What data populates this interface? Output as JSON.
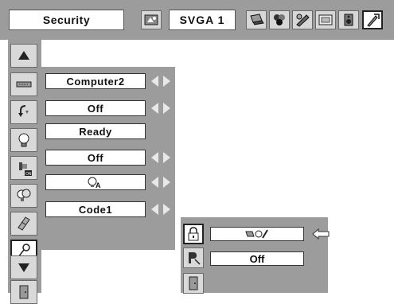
{
  "header": {
    "title": "Security",
    "mode": "SVGA 1",
    "icons": [
      "computer-adjust-icon",
      "laptop-icon",
      "color-circles-icon",
      "picture-adjust-icon",
      "screen-icon",
      "speaker-icon",
      "wrench-icon"
    ]
  },
  "sidebar": {
    "icons": [
      "scroll-up-icon",
      "input-icon",
      "power-management-icon",
      "lamp-icon",
      "on-start-icon",
      "lamp-mode-icon",
      "filter-icon",
      "security-key-icon",
      "scroll-down-icon",
      "exit-icon"
    ]
  },
  "menu": {
    "rows": [
      {
        "value": "Computer2",
        "has_arrows": true
      },
      {
        "value": "Off",
        "has_arrows": true
      },
      {
        "value": "Ready",
        "has_arrows": false
      },
      {
        "value": "Off",
        "has_arrows": true
      },
      {
        "value": "",
        "icon": "lamp-auto-icon",
        "has_arrows": true
      },
      {
        "value": "Code1",
        "has_arrows": true
      }
    ]
  },
  "submenu": {
    "rows": [
      {
        "icon": "lock-icon",
        "value": "",
        "value_icon": "key-lock-icon"
      },
      {
        "icon": "pin-code-icon",
        "value": "Off"
      },
      {
        "icon": "exit-door-icon",
        "value": ""
      }
    ],
    "pointer": "arrow-left-icon"
  },
  "colors": {
    "panel_bg": "#9c9c9c",
    "field_bg": "#ffffff",
    "arrow": "#e8e8e8"
  }
}
